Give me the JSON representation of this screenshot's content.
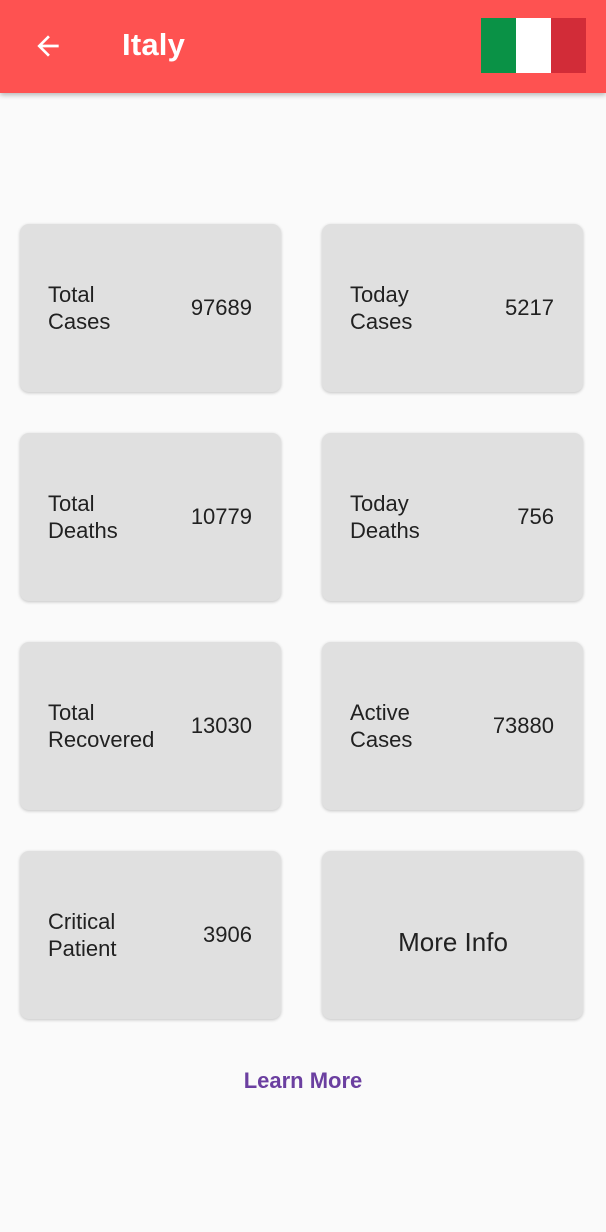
{
  "app_bar": {
    "title": "Italy",
    "back_icon": "arrow-left-icon",
    "background": "#fe5251",
    "flag": {
      "name": "italy-flag",
      "colors": [
        "#0a9246",
        "#ffffff",
        "#d22c38"
      ]
    }
  },
  "stats": [
    {
      "label": "Total\nCases",
      "value": "97689"
    },
    {
      "label": "Today\nCases",
      "value": "5217"
    },
    {
      "label": "Total\nDeaths",
      "value": "10779"
    },
    {
      "label": "Today\nDeaths",
      "value": "756"
    },
    {
      "label": "Total\nRecovered",
      "value": "13030"
    },
    {
      "label": "Active\nCases",
      "value": "73880"
    },
    {
      "label": "Critical\nPatient",
      "value": "3906"
    }
  ],
  "more_info_label": "More Info",
  "learn_more_label": "Learn More",
  "colors": {
    "card": "#e0e0e0",
    "link": "#6b3fa0",
    "page_bg": "#fafafa"
  }
}
